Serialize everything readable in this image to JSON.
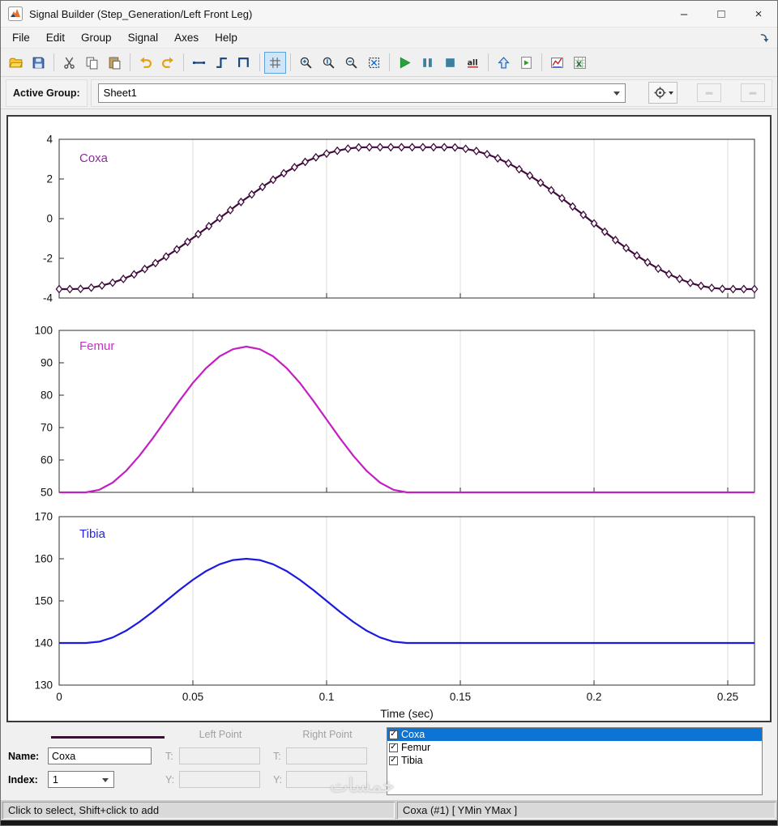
{
  "window": {
    "title": "Signal Builder (Step_Generation/Left Front Leg)",
    "buttons": {
      "minimize": "–",
      "maximize": "□",
      "close": "×"
    }
  },
  "menu": {
    "items": [
      "File",
      "Edit",
      "Group",
      "Signal",
      "Axes",
      "Help"
    ]
  },
  "toolbar": {
    "buttons": [
      {
        "name": "open"
      },
      {
        "name": "save"
      },
      {
        "sep": true
      },
      {
        "name": "cut"
      },
      {
        "name": "copy"
      },
      {
        "name": "paste"
      },
      {
        "sep": true
      },
      {
        "name": "undo"
      },
      {
        "name": "redo"
      },
      {
        "sep": true
      },
      {
        "name": "segment-line"
      },
      {
        "name": "segment-step"
      },
      {
        "name": "segment-pulse"
      },
      {
        "sep": true
      },
      {
        "name": "grid",
        "active": true
      },
      {
        "sep": true
      },
      {
        "name": "zoom-in-x"
      },
      {
        "name": "zoom-in-y"
      },
      {
        "name": "zoom-out"
      },
      {
        "name": "fit-view"
      },
      {
        "sep": true
      },
      {
        "name": "run"
      },
      {
        "name": "pause"
      },
      {
        "name": "stop"
      },
      {
        "name": "build-all"
      },
      {
        "sep": true
      },
      {
        "name": "up-to-parent"
      },
      {
        "name": "open-model"
      },
      {
        "sep": true
      },
      {
        "name": "signal-display"
      },
      {
        "name": "export-excel"
      }
    ]
  },
  "active_group": {
    "label": "Active Group:",
    "value": "Sheet1"
  },
  "xaxis": {
    "label": "Time (sec)",
    "xlim": [
      0,
      0.26
    ],
    "ticks": [
      0,
      0.05,
      0.1,
      0.15,
      0.2,
      0.25
    ],
    "tick_labels": [
      "0",
      "0.05",
      "0.1",
      "0.15",
      "0.2",
      "0.25"
    ]
  },
  "chart_data": [
    {
      "type": "line",
      "name": "Coxa",
      "label_color": "#8a2f98",
      "line_color": "#400b3c",
      "marker": "diamond",
      "ylim": [
        -4,
        4
      ],
      "yticks": [
        -4,
        -2,
        0,
        2,
        4
      ],
      "x": [
        0,
        0.004,
        0.008,
        0.012,
        0.016,
        0.02,
        0.024,
        0.028,
        0.032,
        0.036,
        0.04,
        0.044,
        0.048,
        0.052,
        0.056,
        0.06,
        0.064,
        0.068,
        0.072,
        0.076,
        0.08,
        0.084,
        0.088,
        0.092,
        0.096,
        0.1,
        0.104,
        0.108,
        0.112,
        0.116,
        0.12,
        0.124,
        0.128,
        0.132,
        0.136,
        0.14,
        0.144,
        0.148,
        0.152,
        0.156,
        0.16,
        0.164,
        0.168,
        0.172,
        0.176,
        0.18,
        0.184,
        0.188,
        0.192,
        0.196,
        0.2,
        0.204,
        0.208,
        0.212,
        0.216,
        0.22,
        0.224,
        0.228,
        0.232,
        0.236,
        0.24,
        0.244,
        0.248,
        0.252,
        0.256,
        0.26
      ],
      "y": [
        -3.55,
        -3.55,
        -3.54,
        -3.48,
        -3.37,
        -3.23,
        -3.04,
        -2.81,
        -2.54,
        -2.24,
        -1.91,
        -1.55,
        -1.17,
        -0.78,
        -0.38,
        0.03,
        0.43,
        0.84,
        1.22,
        1.6,
        1.96,
        2.29,
        2.59,
        2.86,
        3.09,
        3.28,
        3.42,
        3.53,
        3.59,
        3.6,
        3.6,
        3.6,
        3.6,
        3.6,
        3.6,
        3.6,
        3.6,
        3.59,
        3.52,
        3.41,
        3.25,
        3.04,
        2.79,
        2.49,
        2.17,
        1.81,
        1.43,
        1.03,
        0.61,
        0.19,
        -0.24,
        -0.66,
        -1.08,
        -1.48,
        -1.86,
        -2.2,
        -2.52,
        -2.8,
        -3.04,
        -3.24,
        -3.39,
        -3.49,
        -3.54,
        -3.55,
        -3.55,
        -3.55
      ]
    },
    {
      "type": "line",
      "name": "Femur",
      "label_color": "#cc2ccc",
      "line_color": "#c320c3",
      "marker": "none",
      "ylim": [
        50,
        100
      ],
      "yticks": [
        50,
        60,
        70,
        80,
        90,
        100
      ],
      "x": [
        0,
        0.005,
        0.01,
        0.015,
        0.02,
        0.025,
        0.03,
        0.035,
        0.04,
        0.045,
        0.05,
        0.055,
        0.06,
        0.065,
        0.07,
        0.075,
        0.08,
        0.085,
        0.09,
        0.095,
        0.1,
        0.105,
        0.11,
        0.115,
        0.12,
        0.125,
        0.13,
        0.135,
        0.14,
        0.145,
        0.15,
        0.155,
        0.16,
        0.165,
        0.17,
        0.175,
        0.18,
        0.185,
        0.19,
        0.195,
        0.2,
        0.205,
        0.21,
        0.215,
        0.22,
        0.225,
        0.23,
        0.235,
        0.24,
        0.245,
        0.25,
        0.255,
        0.26
      ],
      "y": [
        50,
        50,
        50,
        50.8,
        53,
        56.6,
        61.3,
        66.7,
        72.5,
        78.3,
        83.8,
        88.4,
        92,
        94.2,
        95,
        94.2,
        92,
        88.4,
        83.8,
        78.3,
        72.5,
        66.7,
        61.3,
        56.6,
        53,
        50.8,
        50,
        50,
        50,
        50,
        50,
        50,
        50,
        50,
        50,
        50,
        50,
        50,
        50,
        50,
        50,
        50,
        50,
        50,
        50,
        50,
        50,
        50,
        50,
        50,
        50,
        50,
        50
      ]
    },
    {
      "type": "line",
      "name": "Tibia",
      "label_color": "#2424e8",
      "line_color": "#1a1ae0",
      "marker": "none",
      "ylim": [
        130,
        170
      ],
      "yticks": [
        130,
        140,
        150,
        160,
        170
      ],
      "x": [
        0,
        0.005,
        0.01,
        0.015,
        0.02,
        0.025,
        0.03,
        0.035,
        0.04,
        0.045,
        0.05,
        0.055,
        0.06,
        0.065,
        0.07,
        0.075,
        0.08,
        0.085,
        0.09,
        0.095,
        0.1,
        0.105,
        0.11,
        0.115,
        0.12,
        0.125,
        0.13,
        0.135,
        0.14,
        0.145,
        0.15,
        0.155,
        0.16,
        0.165,
        0.17,
        0.175,
        0.18,
        0.185,
        0.19,
        0.195,
        0.2,
        0.205,
        0.21,
        0.215,
        0.22,
        0.225,
        0.23,
        0.235,
        0.24,
        0.245,
        0.25,
        0.255,
        0.26
      ],
      "y": [
        140,
        140,
        140,
        140.3,
        141.3,
        142.9,
        145,
        147.4,
        150,
        152.6,
        155,
        157.1,
        158.7,
        159.7,
        160,
        159.7,
        158.7,
        157.1,
        155,
        152.6,
        150,
        147.4,
        145,
        142.9,
        141.3,
        140.3,
        140,
        140,
        140,
        140,
        140,
        140,
        140,
        140,
        140,
        140,
        140,
        140,
        140,
        140,
        140,
        140,
        140,
        140,
        140,
        140,
        140,
        140,
        140,
        140,
        140,
        140,
        140
      ]
    }
  ],
  "editor": {
    "left_point_label": "Left Point",
    "right_point_label": "Right Point",
    "name_label": "Name:",
    "name_value": "Coxa",
    "index_label": "Index:",
    "index_value": "1",
    "t_label": "T:",
    "y_label": "Y:",
    "signal_list": [
      {
        "label": "Coxa",
        "checked": true,
        "selected": true
      },
      {
        "label": "Femur",
        "checked": true,
        "selected": false
      },
      {
        "label": "Tibia",
        "checked": true,
        "selected": false
      }
    ],
    "selection_color": "#0b74d4"
  },
  "status": {
    "left": "Click to select, Shift+click to add",
    "right": "Coxa (#1)  [ YMin YMax ]"
  },
  "watermark": {
    "text": "خمسات"
  }
}
